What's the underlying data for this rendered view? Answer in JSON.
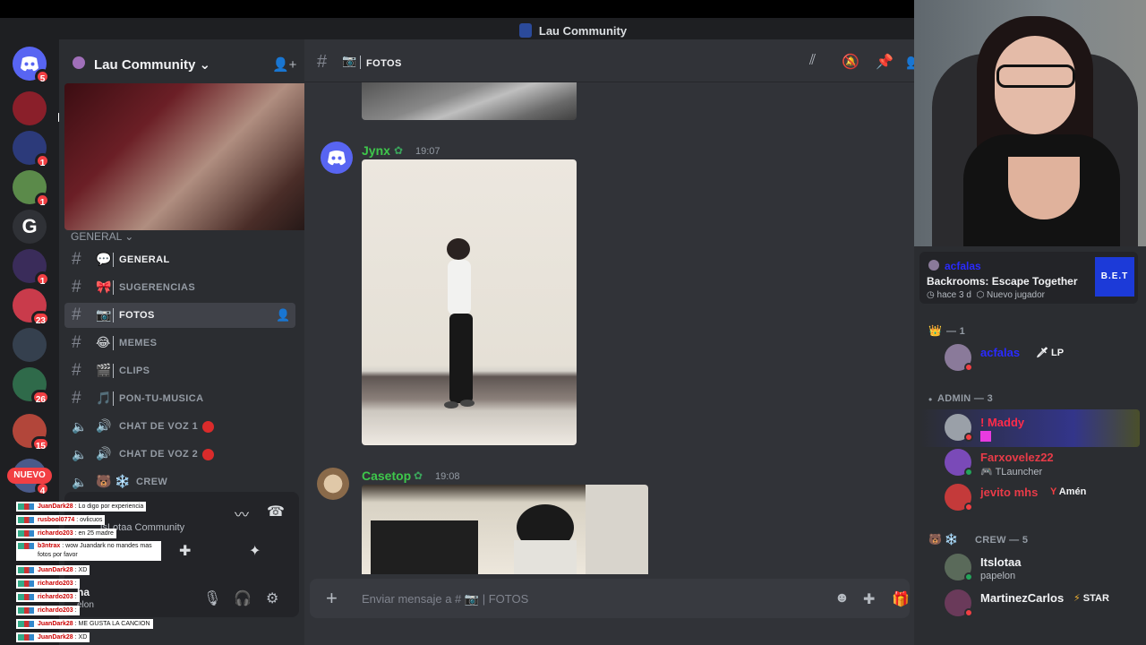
{
  "window": {
    "title": "Lau Community"
  },
  "servers": {
    "nuevo_label": "NUEVO",
    "items": [
      {
        "badge": "5",
        "color": "#5865f2"
      },
      {
        "badge": "",
        "color": "#8a1f2a"
      },
      {
        "badge": "1",
        "color": "#2c3a7a"
      },
      {
        "badge": "1",
        "color": "#5b8a4a"
      },
      {
        "badge": "",
        "color": "#2f3136",
        "letter": "G"
      },
      {
        "badge": "1",
        "color": "#3a2c5a"
      },
      {
        "badge": "23",
        "color": "#c93b4b"
      },
      {
        "badge": "",
        "color": "#35404e"
      },
      {
        "badge": "26",
        "color": "#2f6a4a"
      },
      {
        "badge": "15",
        "color": "#b2463a"
      },
      {
        "badge": "4",
        "color": "#4a5a8a"
      }
    ]
  },
  "sidebar": {
    "server_name": "Lau Community",
    "category": "GENERAL",
    "channels": [
      {
        "emoji": "💬",
        "label": "GENERAL",
        "type": "text",
        "bright": true
      },
      {
        "emoji": "🎀",
        "label": "SUGERENCIAS",
        "type": "text"
      },
      {
        "emoji": "📷",
        "label": "FOTOS",
        "type": "text",
        "active": true
      },
      {
        "emoji": "😂",
        "label": "MEMES",
        "type": "text"
      },
      {
        "emoji": "🎬",
        "label": "CLIPS",
        "type": "text"
      },
      {
        "emoji": "🎵",
        "label": "PON-TU-MUSICA",
        "type": "text"
      },
      {
        "emoji": "🔊",
        "label": "CHAT DE VOZ 1",
        "type": "voice",
        "dot": true
      },
      {
        "emoji": "🔊",
        "label": "CHAT DE VOZ 2",
        "type": "voice",
        "dot": true
      },
      {
        "emoji": "🐻 ❄️",
        "label": "CREW",
        "type": "voice"
      }
    ],
    "voice_connected": "lsLotaa Community",
    "user": {
      "name": "ha",
      "status": "elon"
    }
  },
  "stream_overlay": {
    "lines": [
      {
        "user": "JuanDark28",
        "text": ": Lo digo por experiencia"
      },
      {
        "user": "rusbool0774",
        "text": ": ovlicuos"
      },
      {
        "user": "richardo203",
        "text": ": en 25 madre"
      },
      {
        "user": "b3ntrax",
        "text": ": wow Juandark no mandes mas fotos por favor"
      },
      {
        "user": "JuanDark28",
        "text": ": XD"
      },
      {
        "user": "richardo203",
        "text": ":"
      },
      {
        "user": "richardo203",
        "text": ":"
      },
      {
        "user": "richardo203",
        "text": ":"
      },
      {
        "user": "JuanDark28",
        "text": ": ME GUSTA LA CANCION"
      },
      {
        "user": "JuanDark28",
        "text": ": XD"
      }
    ]
  },
  "channel": {
    "emoji": "📷",
    "name": "FOTOS",
    "messages": [
      {
        "author": "Jynx",
        "author_color": "#3ec74b",
        "time": "19:07"
      },
      {
        "author": "Casetop",
        "author_color": "#3ec74b",
        "time": "19:08"
      }
    ],
    "composer_placeholder": "Enviar mensaje a #",
    "composer_channel": "FOTOS"
  },
  "members": {
    "activity": {
      "user": "acfalas",
      "game": "Backrooms: Escape Together",
      "time": "hace 3 d",
      "note": "Nuevo jugador",
      "game_logo": "B.E.T"
    },
    "groups": [
      {
        "label": "— 1",
        "icon": "👑",
        "members": [
          {
            "name": "acfalas",
            "color": "#2a2aff",
            "tag": "🗡 LP",
            "avatar": "#8a7a9a",
            "status": "red"
          }
        ]
      },
      {
        "label": "ADMIN — 3",
        "icon": "•",
        "members": [
          {
            "name": "! Maddy",
            "color": "#ff2b4a",
            "sub": "",
            "avatar": "#9aa0a8",
            "status": "red"
          },
          {
            "name": "Farxovelez22",
            "color": "#e83b48",
            "sub": "TLauncher",
            "avatar": "#7a4ab8",
            "status": "green"
          },
          {
            "name": "jevito mhs",
            "color": "#e83b48",
            "tag": "Amén",
            "avatar": "#c43a3a",
            "status": "red"
          }
        ]
      },
      {
        "label": "CREW — 5",
        "icon": "🐻 ❄️",
        "members": [
          {
            "name": "Itslotaa",
            "color": "#f2f3f5",
            "sub": "papelon",
            "avatar": "#5a6a5a",
            "status": "green"
          },
          {
            "name": "MartinezCarlos",
            "color": "#f2f3f5",
            "tag": "STAR",
            "avatar": "#6a3a5a",
            "status": "red"
          }
        ]
      }
    ]
  },
  "colors": {
    "accent": "#5865f2",
    "bg_main": "#313338",
    "bg_side": "#2b2d31",
    "bg_rail": "#1e1f22"
  }
}
